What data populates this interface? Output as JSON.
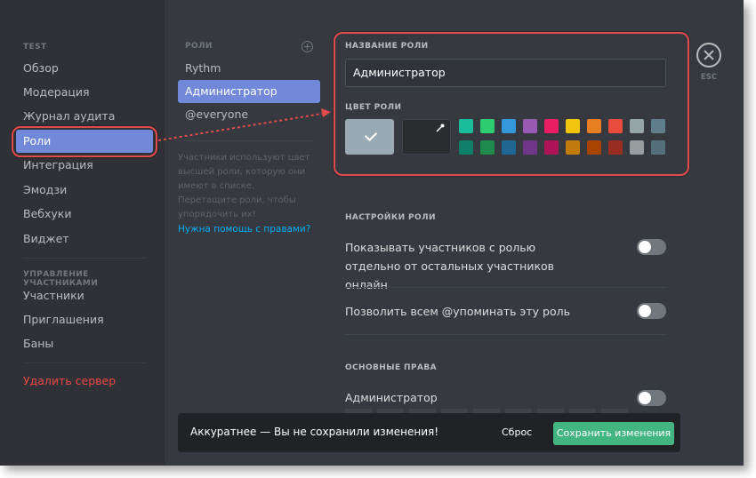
{
  "sidebar": {
    "section_server": "TEST",
    "items": [
      {
        "label": "Обзор"
      },
      {
        "label": "Модерация"
      },
      {
        "label": "Журнал аудита"
      },
      {
        "label": "Роли"
      },
      {
        "label": "Интеграция"
      },
      {
        "label": "Эмодзи"
      },
      {
        "label": "Вебхуки"
      },
      {
        "label": "Виджет"
      }
    ],
    "section_members": "УПРАВЛЕНИЕ УЧАСТНИКАМИ",
    "member_items": [
      {
        "label": "Участники"
      },
      {
        "label": "Приглашения"
      },
      {
        "label": "Баны"
      }
    ],
    "delete_label": "Удалить сервер",
    "active_item": "Роли"
  },
  "roles": {
    "header": "РОЛИ",
    "items": [
      {
        "label": "Rythm"
      },
      {
        "label": "Администратор"
      },
      {
        "label": "@everyone"
      }
    ],
    "active_item": "Администратор",
    "help_text": "Участники используют цвет высшей роли, которую они имеют в списке. Перетащите роли, чтобы упорядочить их!",
    "help_link": "Нужна помощь с правами?"
  },
  "editor": {
    "name_label": "НАЗВАНИЕ РОЛИ",
    "name_value": "Администратор",
    "color_label": "ЦВЕТ РОЛИ",
    "default_color": "#99aab5",
    "swatches_top": [
      "#1abc9c",
      "#2ecc71",
      "#3498db",
      "#9b59b6",
      "#e91e63",
      "#f1c40f",
      "#e67e22",
      "#e74c3c",
      "#95a5a6",
      "#607d8b"
    ],
    "swatches_bottom": [
      "#11806a",
      "#1f8b4c",
      "#206694",
      "#71368a",
      "#ad1457",
      "#c27c0e",
      "#a84300",
      "#992d22",
      "#979c9f",
      "#546e7a"
    ],
    "settings_header": "НАСТРОЙКИ РОЛИ",
    "setting_hoist": "Показывать участников с ролью отдельно от остальных участников онлайн",
    "setting_mention": "Позволить всем @упоминать эту роль",
    "perms_header": "ОСНОВНЫЕ ПРАВА",
    "perm_admin": "Администратор",
    "hoist_on": false,
    "mention_on": false,
    "admin_on": false
  },
  "close": {
    "label": "ESC"
  },
  "notice": {
    "text": "Аккуратнее — Вы не сохранили изменения!",
    "reset_label": "Сброс",
    "save_label": "Сохранить изменения"
  },
  "colors": {
    "accent": "#7289da",
    "danger": "#f04747",
    "success": "#43b581",
    "link": "#00b0f4",
    "annotation": "#e44a4a"
  }
}
